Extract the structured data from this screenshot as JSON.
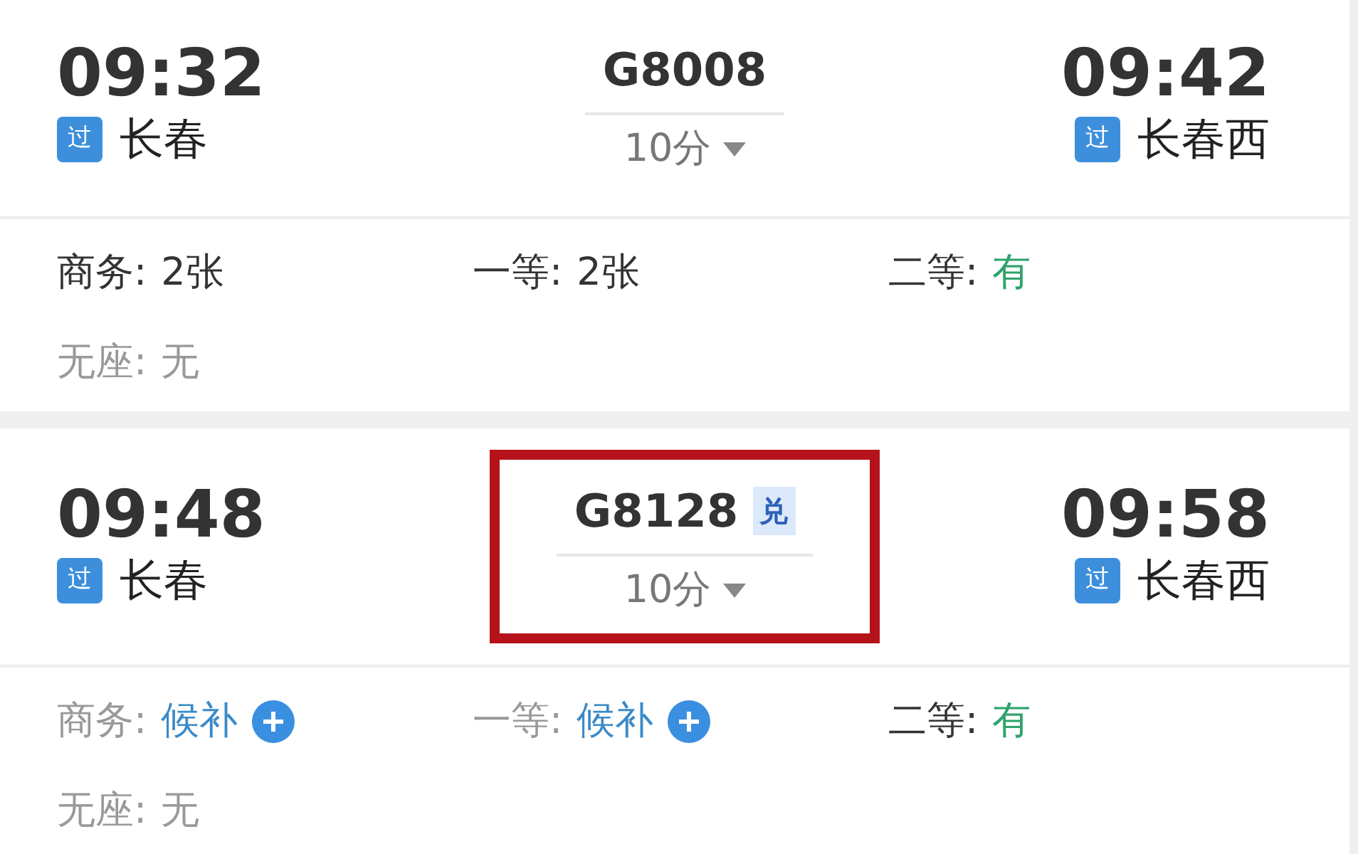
{
  "trains": [
    {
      "depart": {
        "time": "09:32",
        "badge": "过",
        "station": "长春"
      },
      "train_no": "G8008",
      "duration": "10分",
      "arrive": {
        "time": "09:42",
        "badge": "过",
        "station": "长春西"
      },
      "highlighted": false,
      "seats": [
        {
          "label": "商务:",
          "value": "2张",
          "kind": "count"
        },
        {
          "label": "一等:",
          "value": "2张",
          "kind": "count"
        },
        {
          "label": "二等:",
          "value": "有",
          "kind": "available"
        },
        {
          "label": "无座:",
          "value": "无",
          "kind": "none"
        }
      ]
    },
    {
      "depart": {
        "time": "09:48",
        "badge": "过",
        "station": "长春"
      },
      "train_no": "G8128",
      "tag": "兑",
      "duration": "10分",
      "arrive": {
        "time": "09:58",
        "badge": "过",
        "station": "长春西"
      },
      "highlighted": true,
      "seats": [
        {
          "label": "商务:",
          "value": "候补",
          "kind": "waitlist"
        },
        {
          "label": "一等:",
          "value": "候补",
          "kind": "waitlist"
        },
        {
          "label": "二等:",
          "value": "有",
          "kind": "available"
        },
        {
          "label": "无座:",
          "value": "无",
          "kind": "none"
        }
      ]
    }
  ]
}
